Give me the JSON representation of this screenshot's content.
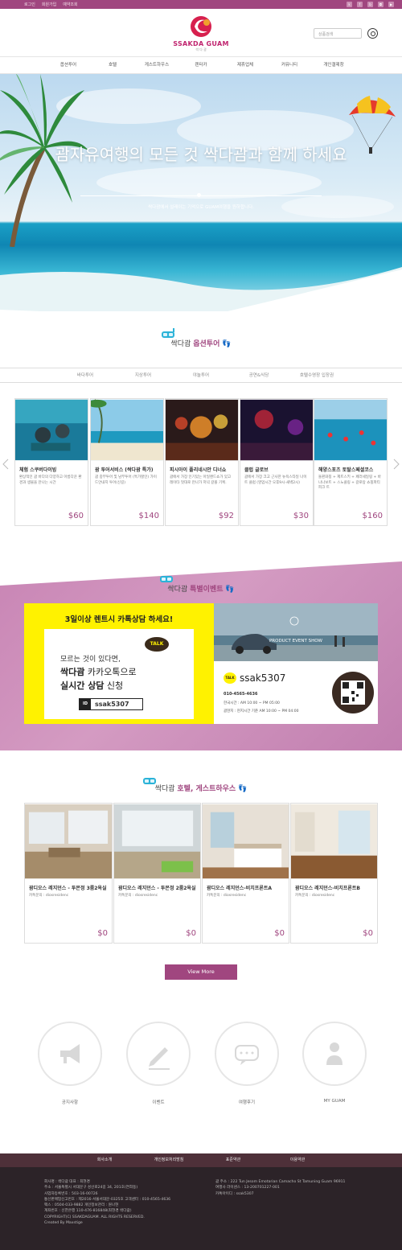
{
  "topbar": {
    "links": [
      "로그인",
      "회원가입",
      "예약조회"
    ],
    "sns_icons": [
      "kakaostory-icon",
      "facebook-icon",
      "blog-icon",
      "instagram-icon",
      "youtube-icon"
    ]
  },
  "header": {
    "logo_text": "SSAKDA GUAM",
    "logo_sub": "싹 다 괌",
    "search_placeholder": "상품검색"
  },
  "nav": [
    "옵션투어",
    "호텔",
    "게스트하우스",
    "렌터카",
    "제휴업체",
    "커뮤니티",
    "개인결제창"
  ],
  "hero": {
    "title": "괌자유여행의 모든 것 싹다괌과 함께 하세요",
    "subtitle": "싹다괌에서 설레이는 기억으로 GUAM여행을 원하합니다."
  },
  "option_tour": {
    "title_prefix": "싹다괌",
    "title_accent": "옵션투어",
    "tabs": [
      "바다투어",
      "지상투어",
      "야놀투어",
      "공연&식당",
      "호텔수영장 입장권"
    ],
    "cards": [
      {
        "title": "체험 스쿠버다이빙",
        "desc": "환상적인 괌 바다의 다양하고 아름다운 환경과 생물을 만나는 시간",
        "price": "$60"
      },
      {
        "title": "괌 투어서비스 (싹다괌 특가)",
        "desc": "괌 중부투어 및 남부투어 (특가할인) 가이드안내지 투어(신길)",
        "price": "$140"
      },
      {
        "title": "피시아이 폴리네시안 디너쇼",
        "desc": "괌에서 가장 인기있는 아일랜드쇼가 있고 레이타 멋대로 만나가 저녁 갈볼 기획.",
        "price": "$92"
      },
      {
        "title": "클럽 글로브",
        "desc": "괌에서 가장 크고 근사한 뉴욕스타일 나이트 클럽 (영업시간 오후9시-새벽2시)",
        "price": "$30"
      },
      {
        "title": "해양스포츠 토탈스페셜코스",
        "desc": "돌핀와칭 + 제트스키 + 페러세일링 + 바나나보트 + 스노클링 + 갈로탕 쇼핑파티피크 트",
        "price": "$160"
      }
    ]
  },
  "event": {
    "title_prefix": "싹다괌",
    "title_accent": "특별이벤트",
    "left_headline": "3일이상 렌트시 카톡상담 하세요!",
    "talk_badge": "TALK",
    "left_line1": "모르는 것이 있다면,",
    "left_line2a": "싹다괌",
    "left_line2b": " 카카오톡으로",
    "left_line3a": "실시간 상담",
    "left_line3b": " 신청",
    "left_id_tag": "ID",
    "left_id": "ssak5307",
    "right_caption": "PRODUCT EVENT SHOW",
    "right_id": "ssak5307",
    "right_talk": "TALK",
    "right_phone": "010-4565-4636",
    "right_hours1": "한국시간 : AM 10:00 ~ PM 05:00",
    "right_hours2": "괌현지 : 현지시간 기준 AM 10:00 ~ PM 04:00"
  },
  "hotels": {
    "title_prefix": "싹다괌",
    "title_accent": "호텔, 게스트하우스",
    "cards": [
      {
        "title": "괌디오스 레지던스 - 투몬정 3룸2욕실",
        "contact": "카톡문의 : diosresidenc",
        "price": "$0"
      },
      {
        "title": "괌디오스 레지던스 - 투몬정 2룸2욕실",
        "contact": "카톡문의 : diosresidenc",
        "price": "$0"
      },
      {
        "title": "괌디오스 레지던스-비치프론트A",
        "contact": "카톡문의 : diosresidenc",
        "price": "$0"
      },
      {
        "title": "괌디오스 레지던스-비치프론트B",
        "contact": "카톡문의 : diosresidenc",
        "price": "$0"
      }
    ],
    "view_more": "View More"
  },
  "circles": [
    {
      "label": "공지사항",
      "icon": "megaphone-icon"
    },
    {
      "label": "이벤트",
      "icon": "pen-icon"
    },
    {
      "label": "여행후기",
      "icon": "speech-bubble-icon"
    },
    {
      "label": "MY GUAM",
      "icon": "person-icon"
    }
  ],
  "footer": {
    "nav": [
      "회사소개",
      "개인정보처리방침",
      "표준약관",
      "이용약관"
    ],
    "left": [
      "회사명 : 싹다괌 대표 : 최현경",
      "주소 : 서울특별시 서대문구 성산로24길 34, 201호(연희동)",
      "사업자등록번호 : 503-16-00726",
      "통신판매업신고번호 : 제2016-서울서대문-0325호  고객센터 : 010-4565-4636",
      "팩스 : 0504-033-9882  개인정보관리 : 원나현",
      "계좌번호 : 신한은행 110-476-816848(최현경 싹다괌)",
      "COPYRIGHT(C) SSAKDAGUAM. ALL RIGHTS RESERVED.",
      "Created By Maxstige"
    ],
    "right": [
      "괌 주소 : 222 Tun Jesom Emotarian Camacho St Tamuning Guam 96911",
      "여행사 라이센스 : 13-200701227-001",
      "카톡아이디 : ssak5307"
    ]
  },
  "colors": {
    "brand": "#a0467f",
    "footer_dark": "#2c2328",
    "footer_nav": "#4e3039",
    "event_bg": "#cc8cba"
  }
}
